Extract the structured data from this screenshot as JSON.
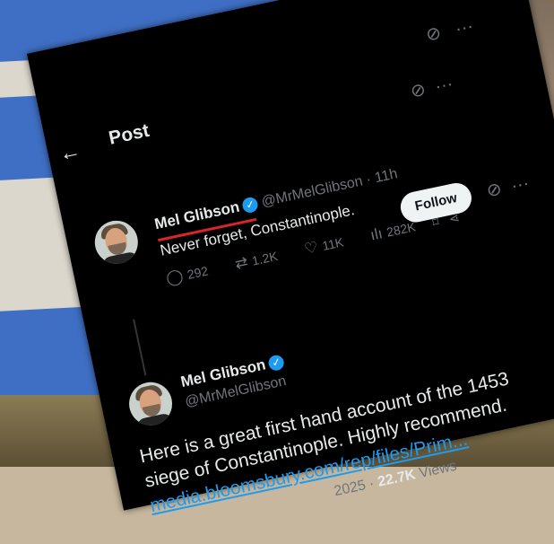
{
  "header": {
    "title": "Post",
    "back_icon": "arrow-left-icon"
  },
  "top_tweet": {
    "name": "Mel Glibson",
    "handle": "@MrMelGlibson",
    "time": "· 11h",
    "text": "Never forget, Constantinople.",
    "replies": "292",
    "reposts": "1.2K",
    "likes": "11K",
    "views": "282K",
    "follow_label": "Follow",
    "underline_color": "#d8252a"
  },
  "quoted_tweet": {
    "name": "Mel Glibson",
    "handle": "@MrMelGlibson",
    "text_line1": "Here is a great first hand account of the 1453",
    "text_line2": "siege of Constantinople. Highly recommend.",
    "link": "media.bloomsbury.com/rep/files/Prim...",
    "date": "2025 ·",
    "views_count": "22.7K",
    "views_label": "Views"
  },
  "colors": {
    "accent": "#1d9bf0",
    "background": "#000000"
  }
}
